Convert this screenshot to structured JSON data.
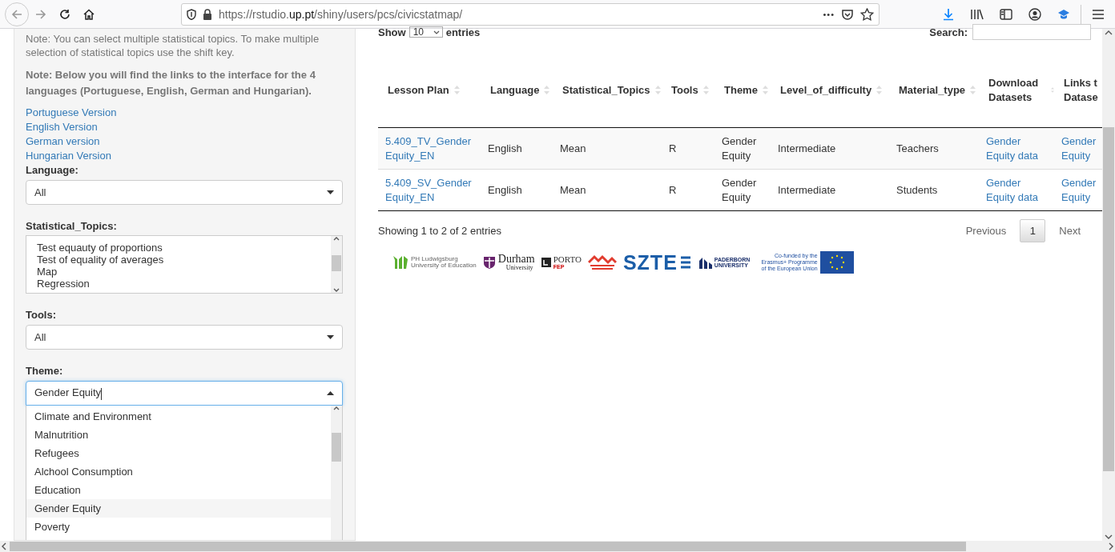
{
  "browser": {
    "url_prefix": "https://rstudio.",
    "url_domain": "up.pt",
    "url_path": "/shiny/users/pcs/civicstatmap/",
    "menu_dots": "•••"
  },
  "sidebar": {
    "note": "Note: You can select multiple statistical topics. To make multiple selection of statistical topics use the shift key.",
    "note_bold": "Note: Below you will find the links to the interface for the 4 languages (Portuguese, English, German and Hungarian).",
    "links": [
      "Portuguese Version",
      "English Version",
      "German version",
      "Hungarian Version"
    ],
    "filters": [
      {
        "kind": "select",
        "label": "Language:",
        "value": "All",
        "open": false
      },
      {
        "kind": "listbox",
        "label": "Statistical_Topics:",
        "options": [
          "Test equauty of proportions",
          "Test of equality of averages",
          "Map",
          "Regression"
        ]
      },
      {
        "kind": "select",
        "label": "Tools:",
        "value": "All",
        "open": false
      },
      {
        "kind": "select",
        "label": "Theme:",
        "value": "Gender Equity",
        "open": true,
        "options": [
          {
            "label": "Climate and Environment",
            "selected": false
          },
          {
            "label": "Malnutrition",
            "selected": false
          },
          {
            "label": "Refugees",
            "selected": false
          },
          {
            "label": "Alchool Consumption",
            "selected": false
          },
          {
            "label": "Education",
            "selected": false
          },
          {
            "label": "Gender Equity",
            "selected": true
          },
          {
            "label": "Poverty",
            "selected": false
          }
        ]
      }
    ]
  },
  "table": {
    "show_label": "Show",
    "page_size": "10",
    "entries_label": "entries",
    "search_label": "Search:",
    "columns": [
      {
        "label": "Lesson Plan",
        "link": true
      },
      {
        "label": "Language",
        "link": false
      },
      {
        "label": "Statistical_Topics",
        "link": false
      },
      {
        "label": "Tools",
        "link": false
      },
      {
        "label": "Theme",
        "link": false
      },
      {
        "label": "Level_of_difficulty",
        "link": false
      },
      {
        "label": "Material_type",
        "link": false
      },
      {
        "label": "Download Datasets",
        "link": true
      },
      {
        "label": "Links t Datase",
        "link": true
      }
    ],
    "rows": [
      [
        "5.409_TV_Gender Equity_EN",
        "English",
        "Mean",
        "R",
        "Gender Equity",
        "Intermediate",
        "Teachers",
        "Gender Equity data",
        "Gender Equity"
      ],
      [
        "5.409_SV_Gender Equity_EN",
        "English",
        "Mean",
        "R",
        "Gender Equity",
        "Intermediate",
        "Students",
        "Gender Equity data",
        "Gender Equity"
      ]
    ],
    "info": "Showing 1 to 2 of 2 entries",
    "pagination": [
      {
        "label": "Previous",
        "kind": "prev",
        "selected": false
      },
      {
        "label": "1",
        "kind": "page",
        "selected": true
      },
      {
        "label": "Next",
        "kind": "next",
        "selected": false
      }
    ]
  },
  "logos": [
    {
      "kind": "ph",
      "lines": [
        "PH Ludwigsburg",
        "University of Education"
      ]
    },
    {
      "kind": "durham",
      "lines": [
        "Durham",
        "University"
      ]
    },
    {
      "kind": "porto",
      "lines": [
        "PORTO",
        "FEP"
      ]
    },
    {
      "kind": "haifa"
    },
    {
      "kind": "szte",
      "lines": [
        "SZTE"
      ]
    },
    {
      "kind": "paderborn",
      "lines": [
        "PADERBORN",
        "UNIVERSITY"
      ]
    },
    {
      "kind": "erasmus",
      "lines": [
        "Co-funded by the",
        "Erasmus+ Programme",
        "of the European Union"
      ]
    }
  ]
}
